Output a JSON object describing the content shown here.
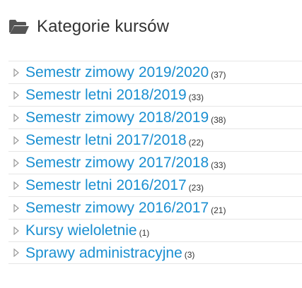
{
  "block": {
    "title": "Kategorie kursów",
    "icon": "folder-open-icon"
  },
  "categories": [
    {
      "name": "Semestr zimowy 2019/2020",
      "count": "(37)"
    },
    {
      "name": "Semestr letni 2018/2019",
      "count": "(33)"
    },
    {
      "name": "Semestr zimowy 2018/2019",
      "count": "(38)"
    },
    {
      "name": "Semestr letni 2017/2018",
      "count": "(22)"
    },
    {
      "name": "Semestr zimowy 2017/2018",
      "count": "(33)"
    },
    {
      "name": "Semestr letni 2016/2017",
      "count": "(23)"
    },
    {
      "name": "Semestr zimowy 2016/2017",
      "count": "(21)"
    },
    {
      "name": "Kursy wieloletnie",
      "count": "(1)"
    },
    {
      "name": "Sprawy administracyjne",
      "count": "(3)"
    }
  ],
  "colors": {
    "link": "#1a8fd1",
    "title": "#333333",
    "icon": "#555555",
    "expand_icon": "#999999",
    "divider": "#e6e6e6"
  }
}
